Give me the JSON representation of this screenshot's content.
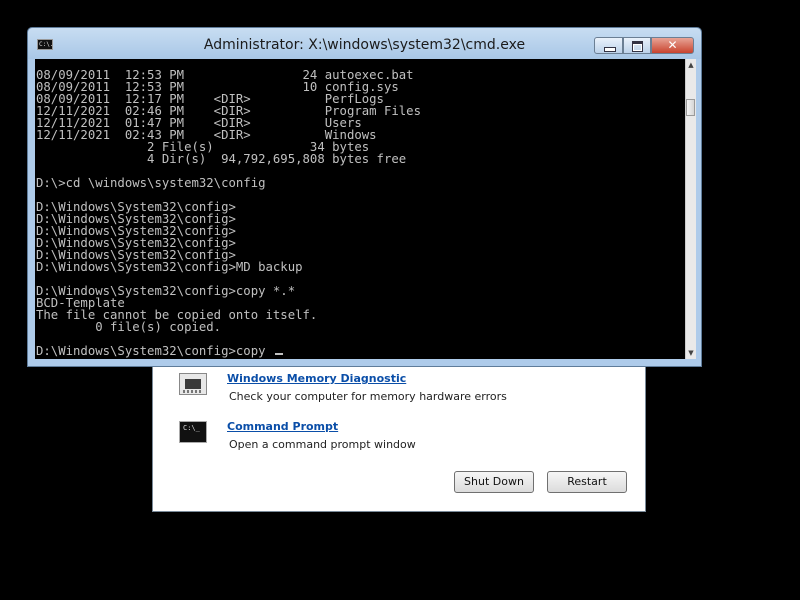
{
  "cmd_window": {
    "title": "Administrator: X:\\windows\\system32\\cmd.exe",
    "icon_label": "C:\\.",
    "close_symbol": "✕",
    "console_lines": [
      "08/09/2011  12:53 PM                24 autoexec.bat",
      "08/09/2011  12:53 PM                10 config.sys",
      "08/09/2011  12:17 PM    <DIR>          PerfLogs",
      "12/11/2021  02:46 PM    <DIR>          Program Files",
      "12/11/2021  01:47 PM    <DIR>          Users",
      "12/11/2021  02:43 PM    <DIR>          Windows",
      "               2 File(s)             34 bytes",
      "               4 Dir(s)  94,792,695,808 bytes free",
      "",
      "D:\\>cd \\windows\\system32\\config",
      "",
      "D:\\Windows\\System32\\config>",
      "D:\\Windows\\System32\\config>",
      "D:\\Windows\\System32\\config>",
      "D:\\Windows\\System32\\config>",
      "D:\\Windows\\System32\\config>",
      "D:\\Windows\\System32\\config>MD backup",
      "",
      "D:\\Windows\\System32\\config>copy *.*",
      "BCD-Template",
      "The file cannot be copied onto itself.",
      "        0 file(s) copied.",
      ""
    ],
    "current_prompt": "D:\\Windows\\System32\\config>copy "
  },
  "recovery": {
    "items": [
      {
        "label": "Windows Memory Diagnostic",
        "description": "Check your computer for memory hardware errors",
        "icon": "memory-chip-icon"
      },
      {
        "label": "Command Prompt",
        "description": "Open a command prompt window",
        "icon": "command-prompt-icon",
        "icon_text": "C:\\_"
      }
    ],
    "shutdown_label": "Shut Down",
    "restart_label": "Restart"
  },
  "colors": {
    "desktop": "#000000",
    "console_text": "#c0c0c0",
    "link": "#0a4ea8",
    "titlebar": "#aecbea",
    "close_button": "#c8432e"
  }
}
